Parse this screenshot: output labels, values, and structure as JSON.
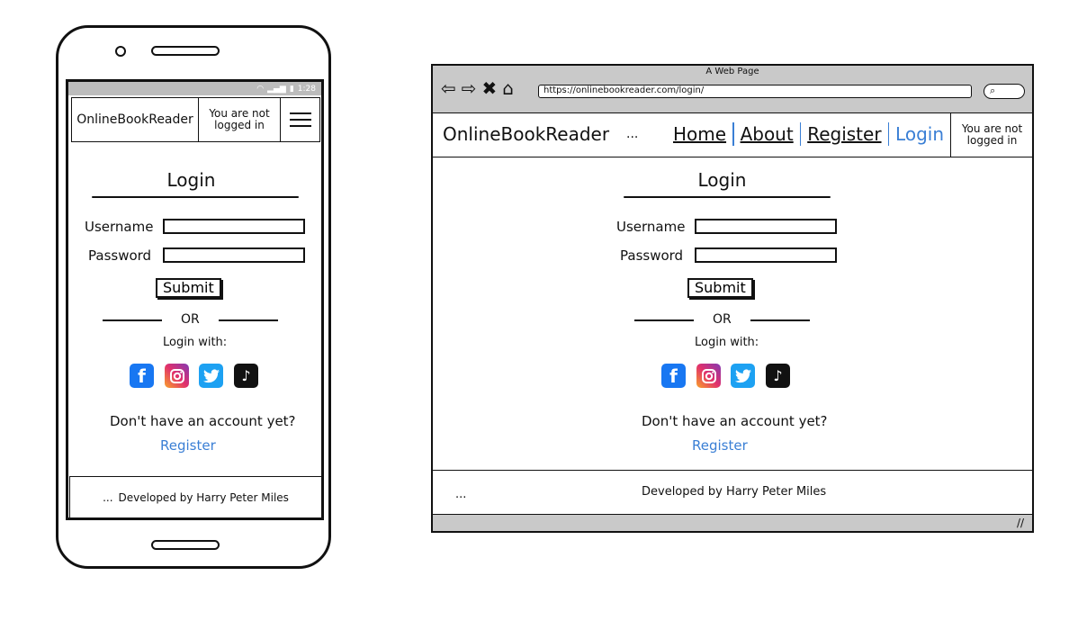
{
  "phone": {
    "status_bar": {
      "time": "1:28"
    },
    "nav": {
      "brand": "OnlineBookReader",
      "login_status": "You are not logged in"
    },
    "login": {
      "title": "Login",
      "username_label": "Username",
      "password_label": "Password",
      "submit_label": "Submit",
      "or_label": "OR",
      "login_with_label": "Login with:",
      "no_account_text": "Don't have an account yet?",
      "register_link": "Register"
    },
    "footer": {
      "dots": "...",
      "credit": "Developed by Harry Peter Miles"
    }
  },
  "browser": {
    "window_title": "A Web Page",
    "url": "https://onlinebookreader.com/login/",
    "nav": {
      "brand": "OnlineBookReader",
      "dots": "...",
      "links": [
        "Home",
        "About",
        "Register",
        "Login"
      ],
      "active_link": "Login",
      "login_status": "You are not logged in"
    },
    "login": {
      "title": "Login",
      "username_label": "Username",
      "password_label": "Password",
      "submit_label": "Submit",
      "or_label": "OR",
      "login_with_label": "Login with:",
      "no_account_text": "Don't have an account yet?",
      "register_link": "Register"
    },
    "footer": {
      "dots": "...",
      "credit": "Developed by Harry Peter Miles"
    }
  },
  "social_icons": [
    "facebook-icon",
    "instagram-icon",
    "twitter-icon",
    "tiktok-icon"
  ],
  "colors": {
    "link": "#3a7fd5",
    "chrome": "#c9c9c9",
    "phone_status": "#bcbcbc"
  }
}
